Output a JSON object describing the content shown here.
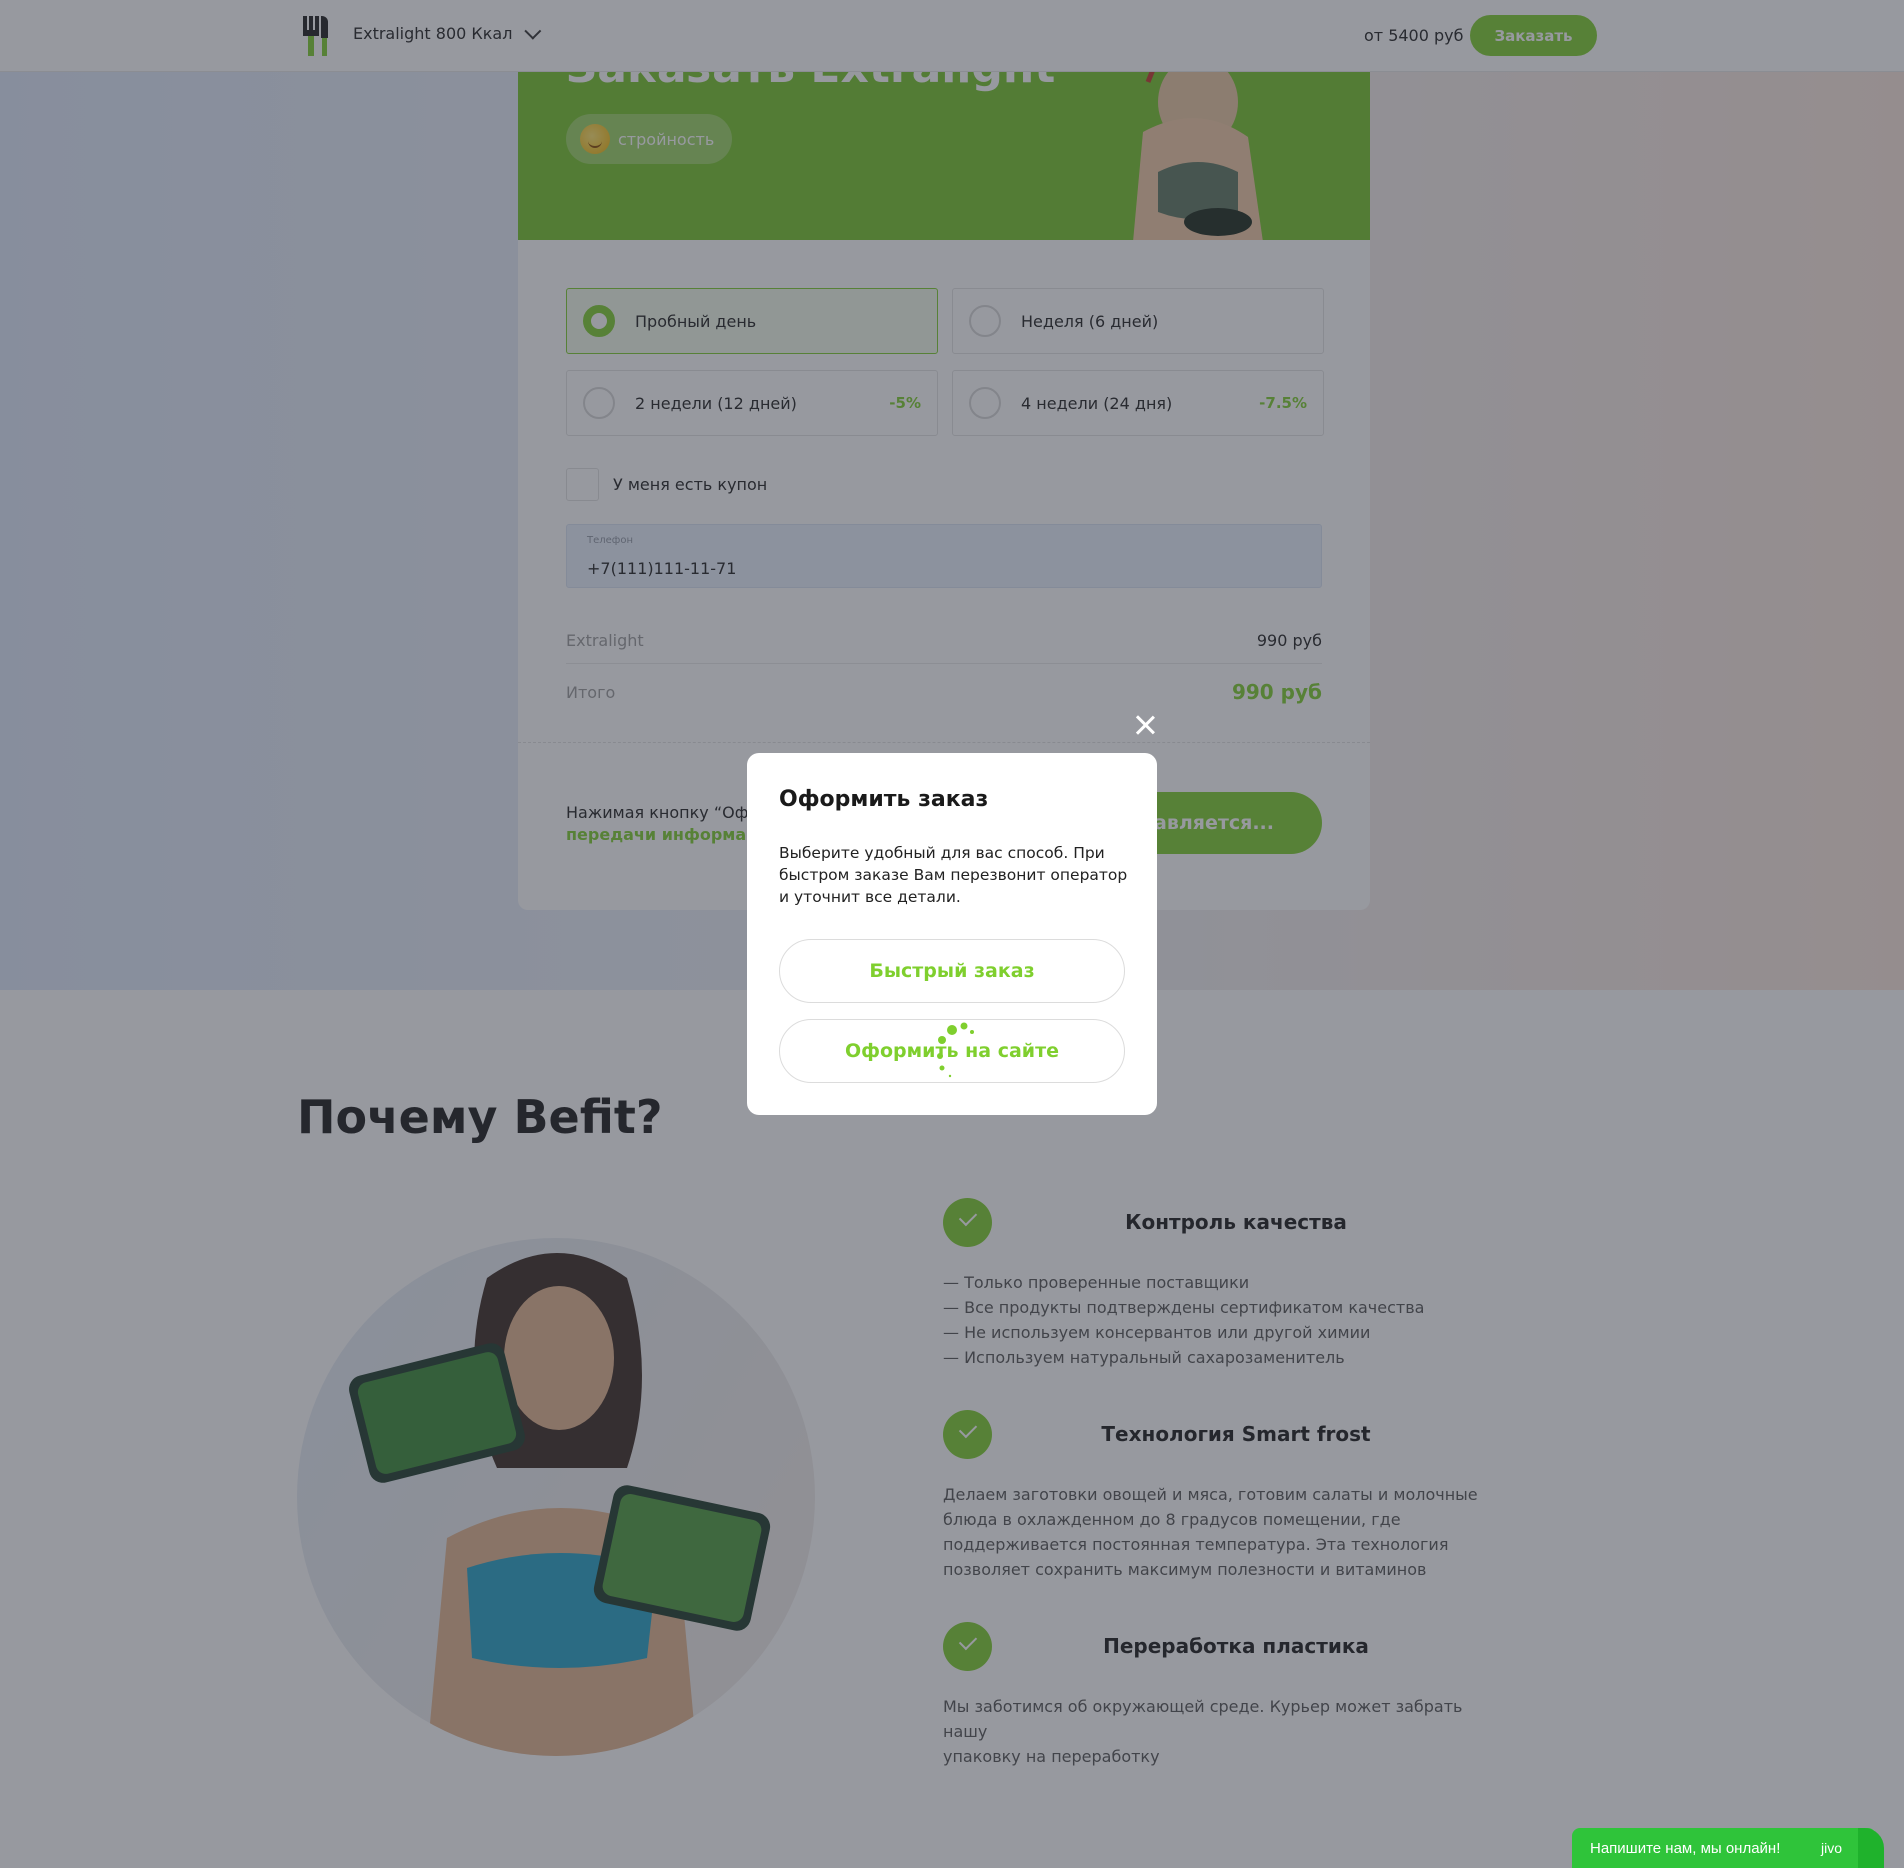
{
  "header": {
    "product": "Extralight 800 Ккал",
    "price_from": "от 5400 руб",
    "order_button": "Заказать"
  },
  "banner": {
    "title": "Заказать Extralight",
    "tag": "стройность"
  },
  "options": [
    {
      "label": "Пробный день",
      "discount": "",
      "selected": true
    },
    {
      "label": "Неделя (6 дней)",
      "discount": "",
      "selected": false
    },
    {
      "label": "2 недели (12 дней)",
      "discount": "-5%",
      "selected": false
    },
    {
      "label": "4 недели (24 дня)",
      "discount": "-7.5%",
      "selected": false
    }
  ],
  "coupon": {
    "label": "У меня есть купон"
  },
  "phone": {
    "label": "Телефон",
    "value": "+7(111)111-11-71"
  },
  "summary": {
    "item_label": "Extralight",
    "item_price": "990 руб",
    "total_label": "Итого",
    "total_price": "990 руб"
  },
  "legal": {
    "text": "Нажимая кнопку “Офор",
    "link": "передачи информации"
  },
  "submit": {
    "label": "равляется..."
  },
  "why": {
    "title": "Почему Befit?",
    "features": [
      {
        "title": "Контроль качества",
        "lines": [
          "— Только проверенные поставщики",
          "— Все продукты подтверждены сертификатом качества",
          "— Не используем консервантов или другой химии",
          "— Используем натуральный сахарозаменитель"
        ]
      },
      {
        "title": "Технология Smart frost",
        "lines": [
          "Делаем заготовки овощей и мяса, готовим салаты и молочные",
          "блюда в охлажденном до 8 градусов помещении, где",
          "поддерживается постоянная температура. Эта технология",
          "позволяет сохранить максимум полезности и витаминов"
        ]
      },
      {
        "title": "Переработка пластика",
        "lines": [
          "Мы заботимся об окружающей среде. Курьер может забрать нашу",
          "упаковку на переработку"
        ]
      }
    ]
  },
  "modal": {
    "title": "Оформить заказ",
    "text": "Выберите удобный для вас способ. При быстром заказе Вам перезвонит оператор и уточнит все детали.",
    "quick_button": "Быстрый заказ",
    "site_button": "Оформить на сайте"
  },
  "chat": {
    "text": "Напишите нам, мы онлайн!",
    "brand": "jivo"
  },
  "colors": {
    "accent": "#7fcf2e",
    "chat": "#2fc43a"
  }
}
